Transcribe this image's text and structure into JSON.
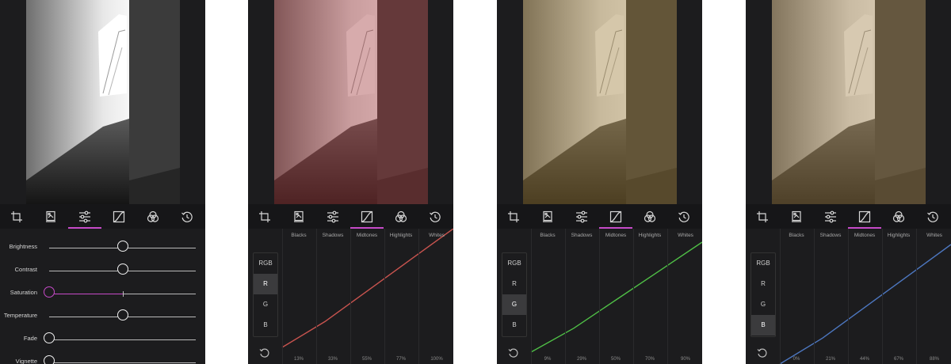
{
  "toolbar_icons": [
    "crop-icon",
    "presets-icon",
    "adjust-sliders-icon",
    "curves-icon",
    "color-mix-icon",
    "history-icon"
  ],
  "panel1": {
    "photo_tint": "grayscale",
    "active_tool": "adjust-sliders-icon",
    "sliders": [
      {
        "label": "Brightness",
        "value": 0.5
      },
      {
        "label": "Contrast",
        "value": 0.5
      },
      {
        "label": "Saturation",
        "value": 0.0,
        "highlight": true,
        "neutral_tick": 0.5
      },
      {
        "label": "Temperature",
        "value": 0.5
      },
      {
        "label": "Fade",
        "value": 0.0
      },
      {
        "label": "Vignette",
        "value": 0.0
      }
    ]
  },
  "curve_panels": [
    {
      "id": "red",
      "active_tool": "curves-icon",
      "columns": [
        "Blacks",
        "Shadows",
        "Midtones",
        "Highlights",
        "Whites"
      ],
      "footer_values": [
        "13%",
        "33%",
        "55%",
        "77%",
        "100%"
      ],
      "channels": [
        "RGB",
        "R",
        "G",
        "B"
      ],
      "selected_channel": "R",
      "curve_color": "#c9544f",
      "tint": "#a0373a"
    },
    {
      "id": "green",
      "active_tool": "curves-icon",
      "columns": [
        "Blacks",
        "Shadows",
        "Midtones",
        "Highlights",
        "Whites"
      ],
      "footer_values": [
        "9%",
        "29%",
        "50%",
        "70%",
        "90%"
      ],
      "channels": [
        "RGB",
        "R",
        "G",
        "B"
      ],
      "selected_channel": "G",
      "curve_color": "#4fbf46",
      "tint": "#9a7a35"
    },
    {
      "id": "blue",
      "active_tool": "curves-icon",
      "columns": [
        "Blacks",
        "Shadows",
        "Midtones",
        "Highlights",
        "Whites"
      ],
      "footer_values": [
        "0%",
        "21%",
        "44%",
        "67%",
        "88%"
      ],
      "channels": [
        "RGB",
        "R",
        "G",
        "B"
      ],
      "selected_channel": "B",
      "curve_color": "#4d77c0",
      "tint": "#a07f45"
    }
  ],
  "colors": {
    "accent": "#c64ac8",
    "panel_bg": "#1c1c1e"
  }
}
